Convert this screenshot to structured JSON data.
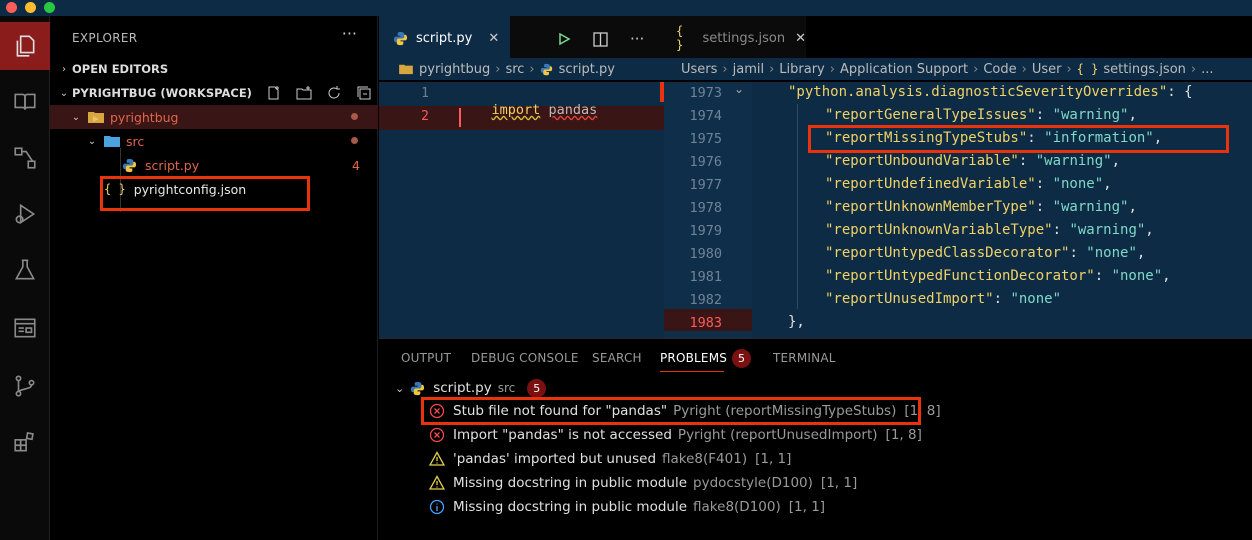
{
  "explorer": {
    "title": "EXPLORER",
    "more": "···",
    "open_editors": "OPEN EDITORS",
    "workspace": "PYRIGHTBUG (WORKSPACE)",
    "tree": {
      "root": "pyrightbug",
      "src": "src",
      "script": "script.py",
      "script_badge": "4",
      "config": "pyrightconfig.json"
    }
  },
  "left_editor": {
    "tab_label": "script.py",
    "tab_close": "✕",
    "more": "···",
    "breadcrumb": [
      "pyrightbug",
      "src",
      "script.py"
    ],
    "lines": [
      {
        "num": "1",
        "code_keyword": "import",
        "code_name": "pandas"
      },
      {
        "num": "2",
        "code_keyword": "",
        "code_name": ""
      }
    ]
  },
  "right_editor": {
    "tab_label": "settings.json",
    "tab_icon": "{ }",
    "tab_close": "✕",
    "breadcrumb": [
      "Users",
      "jamil",
      "Library",
      "Application Support",
      "Code",
      "User",
      "settings.json",
      "..."
    ],
    "lines": [
      {
        "num": "1973",
        "key": "\"python.analysis.diagnosticSeverityOverrides\"",
        "val": "",
        "tail": ": {"
      },
      {
        "num": "1974",
        "key": "\"reportGeneralTypeIssues\"",
        "val": "\"warning\"",
        "tail": ","
      },
      {
        "num": "1975",
        "key": "\"reportMissingTypeStubs\"",
        "val": "\"information\"",
        "tail": ","
      },
      {
        "num": "1976",
        "key": "\"reportUnboundVariable\"",
        "val": "\"warning\"",
        "tail": ","
      },
      {
        "num": "1977",
        "key": "\"reportUndefinedVariable\"",
        "val": "\"none\"",
        "tail": ","
      },
      {
        "num": "1978",
        "key": "\"reportUnknownMemberType\"",
        "val": "\"warning\"",
        "tail": ","
      },
      {
        "num": "1979",
        "key": "\"reportUnknownVariableType\"",
        "val": "\"warning\"",
        "tail": ","
      },
      {
        "num": "1980",
        "key": "\"reportUntypedClassDecorator\"",
        "val": "\"none\"",
        "tail": ","
      },
      {
        "num": "1981",
        "key": "\"reportUntypedFunctionDecorator\"",
        "val": "\"none\"",
        "tail": ","
      },
      {
        "num": "1982",
        "key": "\"reportUnusedImport\"",
        "val": "\"none\"",
        "tail": ""
      },
      {
        "num": "1983",
        "key": "",
        "val": "",
        "tail": "},"
      }
    ]
  },
  "panel": {
    "tabs": [
      "OUTPUT",
      "DEBUG CONSOLE",
      "SEARCH",
      "PROBLEMS",
      "TERMINAL"
    ],
    "problems_count": "5",
    "file": {
      "name": "script.py",
      "dir": "src",
      "count": "5"
    },
    "problems": [
      {
        "severity": "error",
        "message": "Stub file not found for \"pandas\"",
        "source": "Pyright (reportMissingTypeStubs)",
        "position": "[1, 8]"
      },
      {
        "severity": "error",
        "message": "Import \"pandas\" is not accessed",
        "source": "Pyright (reportUnusedImport)",
        "position": "[1, 8]"
      },
      {
        "severity": "warning",
        "message": "'pandas' imported but unused",
        "source": "flake8(F401)",
        "position": "[1, 1]"
      },
      {
        "severity": "warning",
        "message": "Missing docstring in public module",
        "source": "pydocstyle(D100)",
        "position": "[1, 1]"
      },
      {
        "severity": "info",
        "message": "Missing docstring in public module",
        "source": "flake8(D100)",
        "position": "[1, 1]"
      }
    ]
  },
  "colors": {
    "accent_red": "#e8330d",
    "editor_bg": "#0d2b45",
    "key_yellow": "#f0d266",
    "string_teal": "#7fd8c8"
  }
}
